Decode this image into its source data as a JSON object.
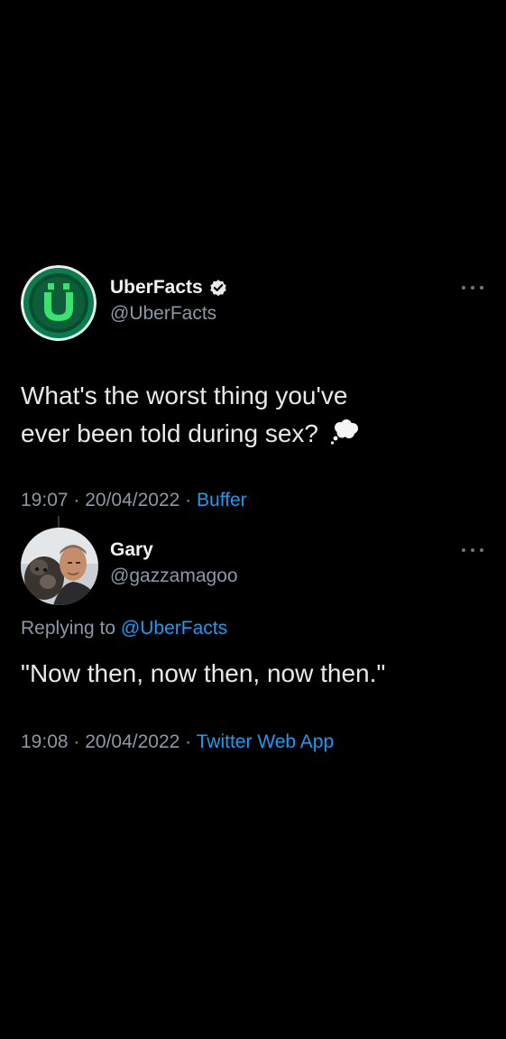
{
  "original_tweet": {
    "display_name": "UberFacts",
    "handle": "@UberFacts",
    "avatar_letter": "Ü",
    "text_line1": "What's the worst thing you've",
    "text_line2": "ever been told during sex?",
    "emoji_icon": "thought-balloon-icon",
    "time": "19:07",
    "separator": " · ",
    "date": "20/04/2022",
    "source": "Buffer",
    "verified": true
  },
  "reply_tweet": {
    "display_name": "Gary",
    "handle": "@gazzamagoo",
    "replying_prefix": "Replying to ",
    "replying_to": "@UberFacts",
    "text": "\"Now then, now then, now then.\"",
    "time": "19:08",
    "separator": " · ",
    "date": "20/04/2022",
    "source": "Twitter Web App"
  },
  "colors": {
    "background": "#000000",
    "link": "#1d9bf0",
    "secondary_text": "#8b98a5",
    "brand_green": "#0a7d4e",
    "brand_lime": "#35e06b"
  }
}
